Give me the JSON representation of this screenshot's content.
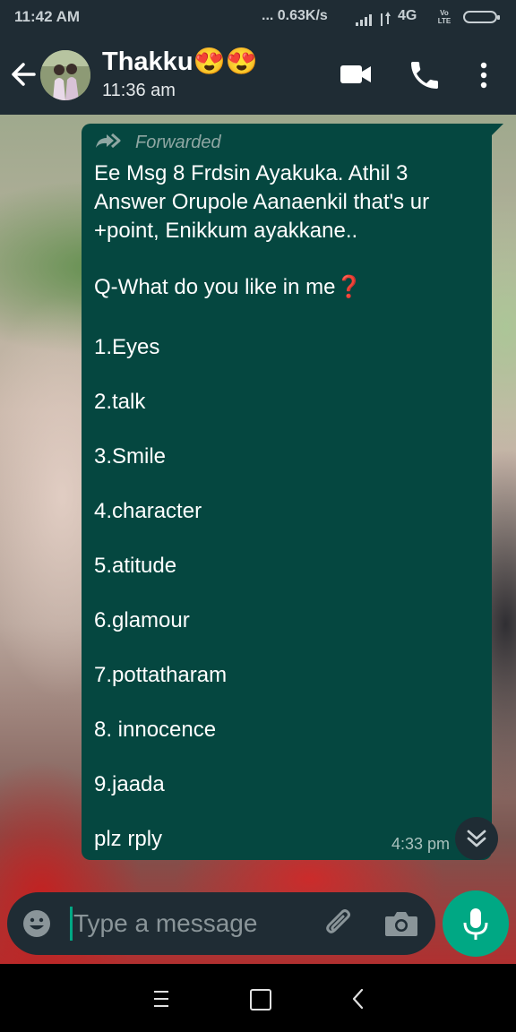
{
  "status_bar": {
    "time": "11:42 AM",
    "speed": "... 0.63K/s",
    "network": "4G",
    "volte": "Vo LTE"
  },
  "header": {
    "contact_name": "Thakku😍😍",
    "last_seen": "11:36 am"
  },
  "message": {
    "forwarded_label": "Forwarded",
    "intro": "Ee Msg 8 Frdsin Ayakuka. Athil 3 Answer Orupole Aanaenkil that's ur +point, Enikkum ayakkane..",
    "question": "Q-What do you like in me",
    "question_icon": "❓",
    "options": [
      "1.Eyes",
      "2.talk",
      "3.Smile",
      "4.character",
      "5.atitude",
      "6.glamour",
      "7.pottatharam",
      "8. innocence",
      "9.jaada"
    ],
    "closing": "plz rply",
    "time": "4:33 pm"
  },
  "input": {
    "placeholder": "Type a message"
  },
  "colors": {
    "header_bg": "#1f2c34",
    "bubble_bg": "#054740",
    "accent": "#00a884"
  },
  "icons": {
    "back": "arrow-left-icon",
    "video": "video-call-icon",
    "call": "phone-icon",
    "menu": "more-vert-icon",
    "forwarded": "forward-arrows-icon",
    "scroll": "double-chevron-down-icon",
    "emoji": "emoji-icon",
    "attach": "paperclip-icon",
    "camera": "camera-icon",
    "mic": "mic-icon"
  }
}
